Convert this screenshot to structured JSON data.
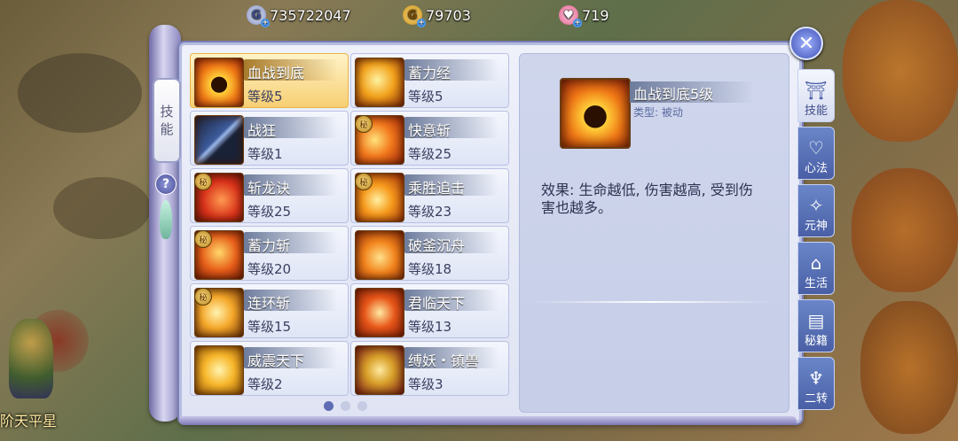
{
  "currencies": [
    {
      "icon": "silver-coin-icon",
      "glyph": "G",
      "value": "735722047"
    },
    {
      "icon": "gold-coin-icon",
      "glyph": "G",
      "value": "79703"
    },
    {
      "icon": "heart-gem-icon",
      "glyph": "♥",
      "value": "719"
    }
  ],
  "scroll_tab": {
    "line1": "技",
    "line2": "能"
  },
  "help_label": "?",
  "skills": [
    {
      "name": "血战到底",
      "level": "等级5",
      "secret": false,
      "selected": true,
      "icon": "dark-figure-flame-icon"
    },
    {
      "name": "蓄力经",
      "level": "等级5",
      "secret": false,
      "selected": false,
      "icon": "sword-swirl-icon"
    },
    {
      "name": "战狂",
      "level": "等级1",
      "secret": false,
      "selected": false,
      "icon": "blue-blade-icon"
    },
    {
      "name": "快意斩",
      "level": "等级25",
      "secret": true,
      "selected": false,
      "icon": "fire-slash-icon"
    },
    {
      "name": "斩龙诀",
      "level": "等级25",
      "secret": true,
      "selected": false,
      "icon": "red-crescent-icon"
    },
    {
      "name": "乘胜追击",
      "level": "等级23",
      "secret": true,
      "selected": false,
      "icon": "flame-burst-icon"
    },
    {
      "name": "蓄力斩",
      "level": "等级20",
      "secret": true,
      "selected": false,
      "icon": "charged-blade-icon"
    },
    {
      "name": "破釜沉舟",
      "level": "等级18",
      "secret": false,
      "selected": false,
      "icon": "fire-wings-icon"
    },
    {
      "name": "连环斩",
      "level": "等级15",
      "secret": true,
      "selected": false,
      "icon": "chain-slash-icon"
    },
    {
      "name": "君临天下",
      "level": "等级13",
      "secret": false,
      "selected": false,
      "icon": "fire-trident-icon"
    },
    {
      "name": "威震天下",
      "level": "等级2",
      "secret": false,
      "selected": false,
      "icon": "golden-figure-icon"
    },
    {
      "name": "缚妖・镇兽",
      "level": "等级3",
      "secret": false,
      "selected": false,
      "icon": "golden-rope-icon"
    }
  ],
  "secret_badge": "秘",
  "detail": {
    "name": "血战到底5级",
    "type": "类型: 被动",
    "effect": "效果: 生命越低, 伤害越高, 受到伤害也越多。"
  },
  "close_label": "✕",
  "side_tabs": [
    {
      "label": "技能",
      "icon": "temple-icon",
      "glyph": "⛩",
      "active": true
    },
    {
      "label": "心法",
      "icon": "heart-hands-icon",
      "glyph": "♡",
      "active": false
    },
    {
      "label": "元神",
      "icon": "spirit-swirl-icon",
      "glyph": "✧",
      "active": false
    },
    {
      "label": "生活",
      "icon": "house-icon",
      "glyph": "⌂",
      "active": false
    },
    {
      "label": "秘籍",
      "icon": "book-icon",
      "glyph": "▤",
      "active": false
    },
    {
      "label": "二转",
      "icon": "trident-icon",
      "glyph": "♆",
      "active": false
    }
  ],
  "page_dots": {
    "count": 3,
    "active": 0
  },
  "player_name": "阶天平星",
  "colors": {
    "accent": "#5f6cb4",
    "selected": "#f7cf73",
    "fire": "#e8541a"
  }
}
